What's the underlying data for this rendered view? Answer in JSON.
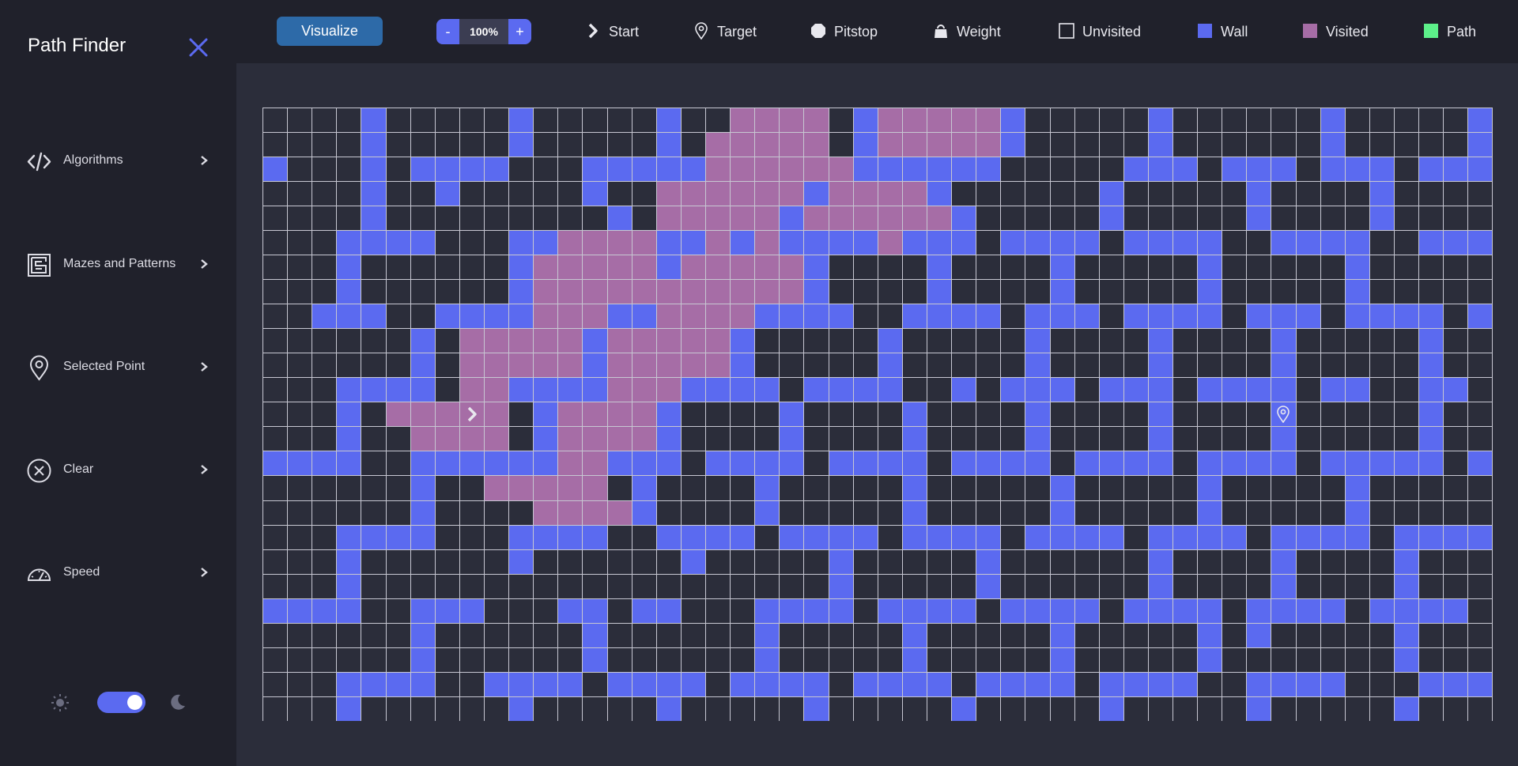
{
  "sidebar": {
    "title": "Path Finder",
    "items": [
      {
        "label": "Algorithms",
        "icon": "code-icon"
      },
      {
        "label": "Mazes and Patterns",
        "icon": "maze-icon"
      },
      {
        "label": "Selected Point",
        "icon": "map-pin-icon"
      },
      {
        "label": "Clear",
        "icon": "clear-circle-x-icon"
      },
      {
        "label": "Speed",
        "icon": "speedometer-icon"
      }
    ],
    "theme": "dark"
  },
  "toolbar": {
    "visualize_label": "Visualize",
    "zoom_minus": "-",
    "zoom_value": "100%",
    "zoom_plus": "+"
  },
  "legend": [
    {
      "label": "Start",
      "icon": "chevron-right-icon"
    },
    {
      "label": "Target",
      "icon": "map-pin-icon"
    },
    {
      "label": "Pitstop",
      "icon": "octagon-icon"
    },
    {
      "label": "Weight",
      "icon": "weight-icon"
    },
    {
      "label": "Unvisited",
      "icon": "empty-square-icon"
    },
    {
      "label": "Wall",
      "icon": "wall-square-icon",
      "color": "#5b6af0"
    },
    {
      "label": "Visited",
      "icon": "visited-square-icon",
      "color": "#a66da6"
    },
    {
      "label": "Path",
      "icon": "path-square-icon",
      "color": "#5df08a"
    }
  ],
  "colors": {
    "unvisited": "#2b2d3a",
    "wall": "#5b6af0",
    "visited": "#a66da6",
    "path": "#5df08a",
    "accent": "#2d6aa8"
  },
  "grid": {
    "rows": [
      "0000100000100000100222201222221000001000000100000100",
      "00001000001000001022222012222210000010000001000001",
      "10001011110001111122222211111100000111011101110111101",
      "00001001000001002222221222210000001000001000010000100",
      "00001000000000102222212222221000001000001000010000100",
      "00011110001122221121211112111011110111100111100111110",
      "00010000001222221222221000010000100000100000100000100",
      "00010000001222222222221000010000100000100000100000100",
      "00111001111222112222111100111101110111101110111101111",
      "00000010222221222221000001000001000010000100000100001",
      "00000010222221222221000001000001000010000100000100001",
      "00011110221111222111101111001011101110111101100110111",
      "00010222220122221000010000100001000010000100000100000",
      "00010022220122221000010000100001000010000100000100000",
      "11110011111122111011110111101111011110111101111101111",
      "00000010022222010000100000100000100000100000100000100",
      "00000010000222210000100000100000100000100000100000100",
      "00011110001111001111011110111101111011110111101111101",
      "00010000001000000100000100000100000010000100001000000",
      "00010000000000000000000100000100000010000100001000000",
      "11110011100011011000111101111011110111101111011110111",
      "00000010000001000000100000100000100000101000001000000",
      "00000010000001000000100000100000100000100000001000000",
      "00011110011110111101111011110111101111001111000111101",
      "00010000001000001000001000001000001000001000001000000"
    ],
    "start": {
      "row": 12,
      "col": 8
    },
    "target": {
      "row": 12,
      "col": 41
    }
  }
}
